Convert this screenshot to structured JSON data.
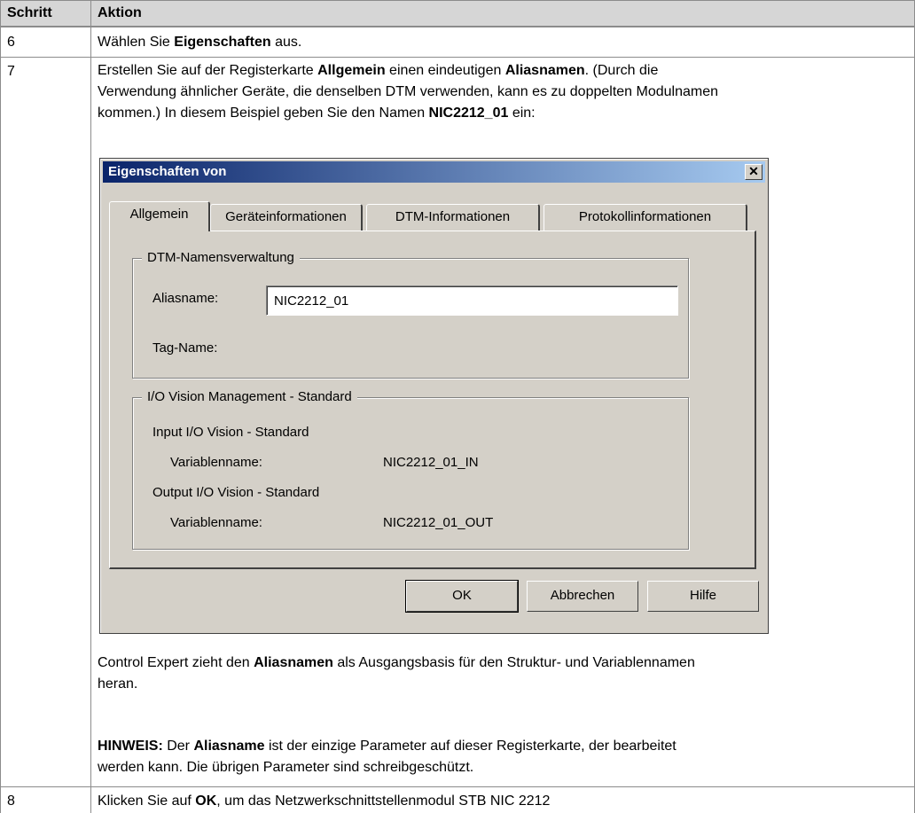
{
  "table": {
    "header": {
      "col1": "Schritt",
      "col2": "Aktion"
    },
    "row6": {
      "step": "6",
      "pre": "Wählen Sie ",
      "bold": "Eigenschaften",
      "post": " aus."
    },
    "row7": {
      "step": "7",
      "l1_a": "Erstellen Sie auf der Registerkarte ",
      "l1_b": "Allgemein",
      "l1_c": " einen eindeutigen ",
      "l1_d": "Aliasnamen",
      "l1_e": ". (Durch die",
      "l2": "Verwendung ähnlicher Geräte, die denselben DTM verwenden, kann es zu doppelten Modulnamen",
      "l3_a": "kommen.) In diesem Beispiel geben Sie den Namen ",
      "l3_b": "NIC2212_01",
      "l3_c": " ein:",
      "after1_a": "Control Expert zieht den ",
      "after1_b": "Aliasnamen",
      "after1_c": " als Ausgangsbasis für den Struktur- und Variablennamen",
      "after2": "heran.",
      "note_label": "HINWEIS:",
      "note_a": " Der ",
      "note_b": "Aliasname",
      "note_c": " ist der einzige Parameter auf dieser Registerkarte, der bearbeitet",
      "note2": "werden kann. Die übrigen Parameter sind schreibgeschützt."
    },
    "row8": {
      "step": "8",
      "pre": "Klicken Sie auf ",
      "bold": "OK",
      "post": ", um das Netzwerkschnittstellenmodul STB NIC 2212"
    }
  },
  "dialog": {
    "title": "Eigenschaften von",
    "tabs": [
      "Allgemein",
      "Geräteinformationen",
      "DTM-Informationen",
      "Protokollinformationen"
    ],
    "group1_title": "DTM-Namensverwaltung",
    "alias_label": "Aliasname:",
    "alias_value": "NIC2212_01",
    "tag_label": "Tag-Name:",
    "group2_title": "I/O Vision Management - Standard",
    "input_title": "Input I/O Vision - Standard",
    "input_var_label": "Variablenname:",
    "input_var_value": "NIC2212_01_IN",
    "output_title": "Output I/O Vision - Standard",
    "output_var_label": "Variablenname:",
    "output_var_value": "NIC2212_01_OUT",
    "buttons": {
      "ok": "OK",
      "cancel": "Abbrechen",
      "help": "Hilfe"
    },
    "close_glyph": "✕"
  }
}
